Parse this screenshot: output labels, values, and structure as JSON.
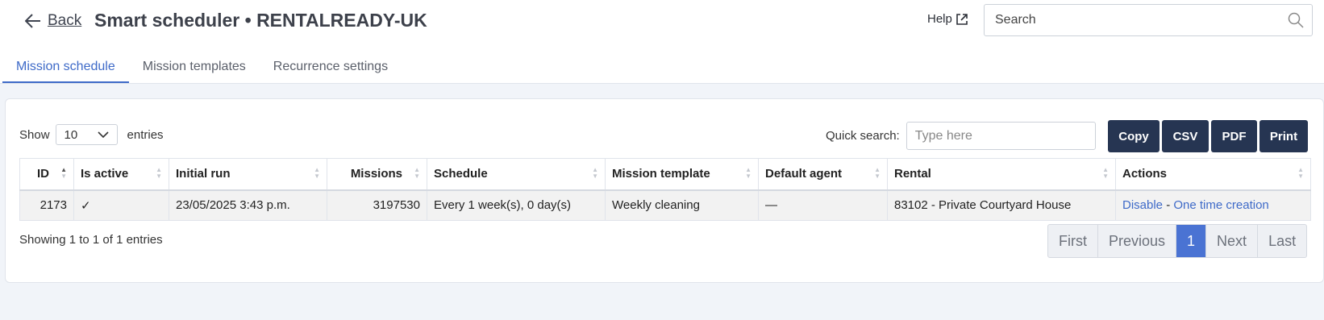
{
  "header": {
    "back_label": "Back",
    "title": "Smart scheduler • RENTALREADY-UK",
    "help_label": "Help",
    "search_placeholder": "Search"
  },
  "tabs": [
    {
      "label": "Mission schedule",
      "active": true
    },
    {
      "label": "Mission templates",
      "active": false
    },
    {
      "label": "Recurrence settings",
      "active": false
    }
  ],
  "table_controls": {
    "show_label": "Show",
    "show_value": "10",
    "entries_label": "entries",
    "quick_search_label": "Quick search:",
    "quick_search_placeholder": "Type here",
    "buttons": [
      "Copy",
      "CSV",
      "PDF",
      "Print"
    ]
  },
  "table": {
    "headers": [
      "ID",
      "Is active",
      "Initial run",
      "Missions",
      "Schedule",
      "Mission template",
      "Default agent",
      "Rental",
      "Actions"
    ],
    "rows": [
      {
        "id": "2173",
        "is_active": "✓",
        "initial_run": "23/05/2025 3:43 p.m.",
        "missions": "3197530",
        "schedule": "Every 1 week(s), 0 day(s)",
        "mission_template": "Weekly cleaning",
        "default_agent": "—",
        "rental": "83102 - Private Courtyard House",
        "action_disable": "Disable",
        "action_sep": "-",
        "action_one_time": "One time creation"
      }
    ]
  },
  "footer": {
    "info": "Showing 1 to 1 of 1 entries",
    "pagination": [
      "First",
      "Previous",
      "1",
      "Next",
      "Last"
    ]
  },
  "colors": {
    "accent": "#3e6ac8",
    "button_bg": "#263552",
    "page_bg": "#f1f4f9",
    "pager_current": "#4a73d3"
  }
}
